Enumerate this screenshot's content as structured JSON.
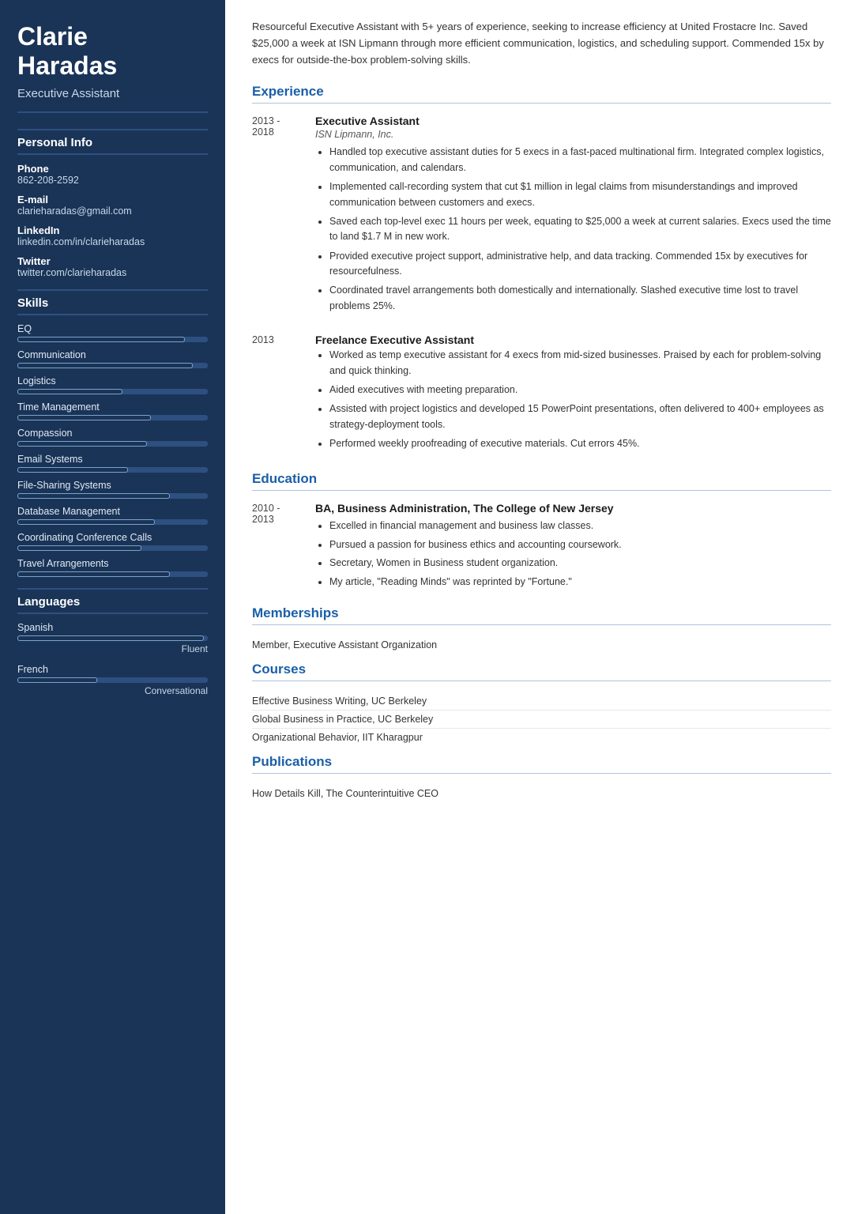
{
  "sidebar": {
    "name": "Clarie\nHaradas",
    "name_line1": "Clarie",
    "name_line2": "Haradas",
    "title": "Executive Assistant",
    "personal_info_label": "Personal Info",
    "personal": [
      {
        "label": "Phone",
        "value": "862-208-2592"
      },
      {
        "label": "E-mail",
        "value": "clarieharadas@gmail.com"
      },
      {
        "label": "LinkedIn",
        "value": "linkedin.com/in/clarieharadas"
      },
      {
        "label": "Twitter",
        "value": "twitter.com/clarieharadas"
      }
    ],
    "skills_label": "Skills",
    "skills": [
      {
        "name": "EQ",
        "pct": 88
      },
      {
        "name": "Communication",
        "pct": 92
      },
      {
        "name": "Logistics",
        "pct": 55
      },
      {
        "name": "Time Management",
        "pct": 70
      },
      {
        "name": "Compassion",
        "pct": 68
      },
      {
        "name": "Email Systems",
        "pct": 58
      },
      {
        "name": "File-Sharing Systems",
        "pct": 80
      },
      {
        "name": "Database Management",
        "pct": 72
      },
      {
        "name": "Coordinating Conference Calls",
        "pct": 65
      },
      {
        "name": "Travel Arrangements",
        "pct": 80
      }
    ],
    "languages_label": "Languages",
    "languages": [
      {
        "name": "Spanish",
        "pct": 98,
        "level": "Fluent"
      },
      {
        "name": "French",
        "pct": 42,
        "level": "Conversational"
      }
    ]
  },
  "main": {
    "summary": "Resourceful Executive Assistant with 5+ years of experience, seeking to increase efficiency at United Frostacre Inc. Saved $25,000 a week at ISN Lipmann through more efficient communication, logistics, and scheduling support. Commended 15x by execs for outside-the-box problem-solving skills.",
    "experience_label": "Experience",
    "experience": [
      {
        "dates": "2013 -\n2018",
        "title": "Executive Assistant",
        "company": "ISN Lipmann, Inc.",
        "bullets": [
          "Handled top executive assistant duties for 5 execs in a fast-paced multinational firm. Integrated complex logistics, communication, and calendars.",
          "Implemented call-recording system that cut $1 million in legal claims from misunderstandings and improved communication between customers and execs.",
          "Saved each top-level exec 11 hours per week, equating to $25,000 a week at current salaries. Execs used the time to land $1.7 M in new work.",
          "Provided executive project support, administrative help, and data tracking. Commended 15x by executives for resourcefulness.",
          "Coordinated travel arrangements both domestically and internationally. Slashed executive time lost to travel problems 25%."
        ]
      },
      {
        "dates": "2013",
        "title": "Freelance Executive Assistant",
        "company": "",
        "bullets": [
          "Worked as temp executive assistant for 4 execs from mid-sized businesses. Praised by each for problem-solving and quick thinking.",
          "Aided executives with meeting preparation.",
          "Assisted with project logistics and developed 15 PowerPoint presentations, often delivered to 400+ employees as strategy-deployment tools.",
          "Performed weekly proofreading of executive materials. Cut errors 45%."
        ]
      }
    ],
    "education_label": "Education",
    "education": [
      {
        "dates": "2010 -\n2013",
        "title": "BA, Business Administration, The College of New Jersey",
        "bullets": [
          "Excelled in financial management and business law classes.",
          "Pursued a passion for business ethics and accounting coursework.",
          "Secretary, Women in Business student organization.",
          "My article, \"Reading Minds\" was reprinted by \"Fortune.\""
        ]
      }
    ],
    "memberships_label": "Memberships",
    "memberships": [
      "Member, Executive Assistant Organization"
    ],
    "courses_label": "Courses",
    "courses": [
      "Effective Business Writing, UC Berkeley",
      "Global Business in Practice, UC Berkeley",
      "Organizational Behavior, IIT Kharagpur"
    ],
    "publications_label": "Publications",
    "publications": [
      "How Details Kill, The Counterintuitive CEO"
    ]
  }
}
